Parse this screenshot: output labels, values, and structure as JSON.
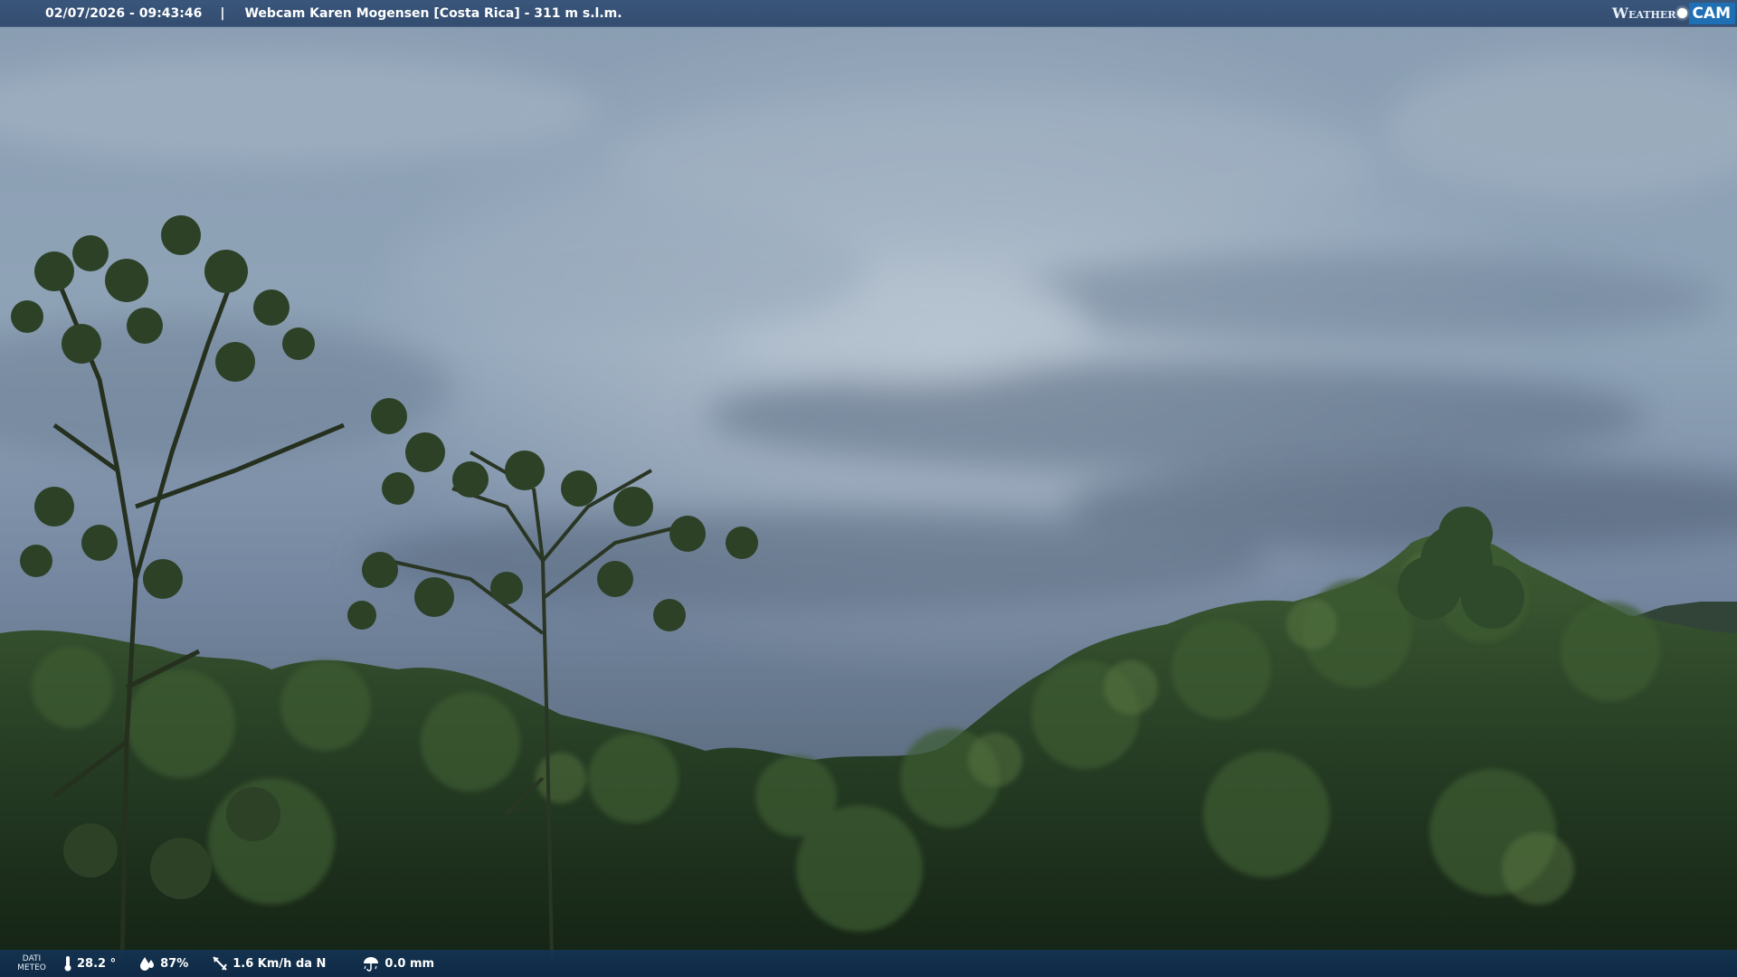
{
  "header": {
    "datetime": "02/07/2026 - 09:43:46",
    "separator": "|",
    "title": "Webcam Karen Mogensen [Costa Rica]  - 311 m s.l.m."
  },
  "brand": {
    "weather": "Weather",
    "cam": "CAM"
  },
  "footer": {
    "dati_line1": "DATI",
    "dati_line2": "METEO",
    "temperature": "28.2 °",
    "humidity": "87%",
    "wind": "1.6 Km/h da N",
    "rain": "0.0 mm"
  },
  "colors": {
    "sky_top": "#8fa2b6",
    "sky_mid": "#7d90a5",
    "sky_low": "#5b6b80",
    "forest_dark": "#1c2a1c",
    "forest_mid": "#2e4a2c",
    "forest_light": "#4f6f3e",
    "bar_blue": "#2c4a72",
    "brand_blue": "#1e6fb4"
  }
}
